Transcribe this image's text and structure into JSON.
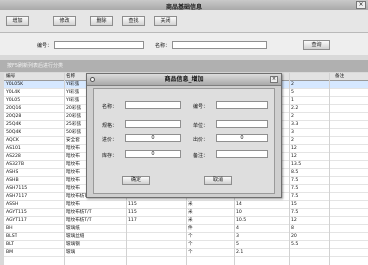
{
  "window": {
    "title": "商品基础信息",
    "close_label": "×"
  },
  "toolbar": {
    "buttons": [
      "增加",
      "修改",
      "删除",
      "查找",
      "关闭"
    ]
  },
  "search": {
    "code_label": "编号：",
    "name_label": "名称：",
    "query_label": "查询"
  },
  "hint": "按F5刷新列表后进行分类",
  "table": {
    "headers": [
      "编号",
      "名称",
      "",
      "",
      "",
      "",
      "备注"
    ],
    "rows": [
      [
        "Y0L05K",
        "YI彩弦",
        "",
        "",
        "",
        "2",
        ""
      ],
      [
        "Y0L4K",
        "YI彩弦",
        "",
        "",
        "",
        "5",
        ""
      ],
      [
        "Y0L05",
        "YI彩弦",
        "",
        "",
        "",
        "1",
        ""
      ],
      [
        "20Q16",
        "20彩弦",
        "",
        "",
        "",
        "2.2",
        ""
      ],
      [
        "20Q28",
        "20彩弦",
        "",
        "",
        "",
        "2",
        ""
      ],
      [
        "25Q4K",
        "25彩弦",
        "",
        "",
        "",
        "3.3",
        ""
      ],
      [
        "50Q4K",
        "50彩弦",
        "",
        "",
        "",
        "3",
        ""
      ],
      [
        "AQCK",
        "安全套",
        "",
        "",
        "",
        "2",
        ""
      ],
      [
        "AS101",
        "暗纹布",
        "",
        "",
        "",
        "12",
        ""
      ],
      [
        "AS228",
        "暗纹布",
        "",
        "",
        "",
        "12",
        ""
      ],
      [
        "AS327B",
        "暗纹布",
        "",
        "",
        "",
        "13.5",
        ""
      ],
      [
        "ASHS",
        "暗纹布",
        "",
        "",
        "",
        "8.5",
        ""
      ],
      [
        "ASHB",
        "暗纹布",
        "",
        "",
        "",
        "7.5",
        ""
      ],
      [
        "ASH7115",
        "暗纹布",
        "",
        "",
        "",
        "7.5",
        ""
      ],
      [
        "ASH7117",
        "暗纹布纺T/T",
        "117",
        "米",
        "15",
        "7.5",
        ""
      ],
      [
        "ASSH",
        "暗纹布",
        "115",
        "米",
        "14",
        "15",
        ""
      ],
      [
        "AGYT115",
        "暗纹布纺T/T",
        "115",
        "米",
        "10",
        "7.5",
        ""
      ],
      [
        "AGYT117",
        "暗纹布纺T/T",
        "117",
        "米",
        "10.5",
        "12",
        ""
      ],
      [
        "BH",
        "玻璃纸",
        "",
        "件",
        "4",
        "8",
        ""
      ],
      [
        "BLST",
        "玻璃丝缝",
        "",
        "个",
        "3",
        "20",
        ""
      ],
      [
        "BLT",
        "玻璃钢",
        "",
        "个",
        "5",
        "5.5",
        ""
      ],
      [
        "BM",
        "玻璃",
        "",
        "个",
        "2.1",
        "",
        ""
      ]
    ]
  },
  "dialog": {
    "title": "商品信息_增加",
    "close_label": "×",
    "fields": {
      "name_label": "名称：",
      "code_label": "编号：",
      "spec_label": "规格：",
      "unit_label": "单位：",
      "purchase_label": "进价：",
      "purchase_value": "0",
      "sale_label": "出价：",
      "sale_value": "0",
      "stock_label": "库存：",
      "stock_value": "0",
      "remark_label": "备注："
    },
    "ok_label": "确定",
    "cancel_label": "取消"
  }
}
